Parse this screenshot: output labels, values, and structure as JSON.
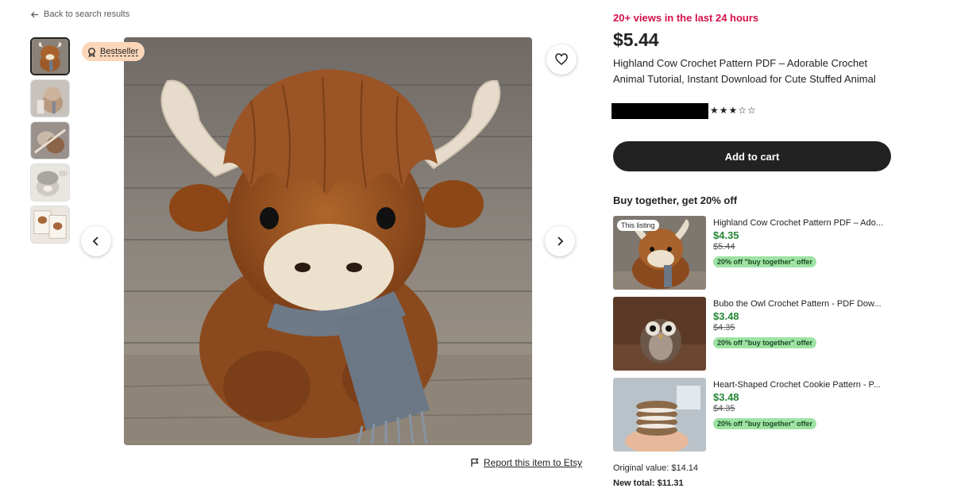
{
  "nav": {
    "back_label": "Back to search results"
  },
  "gallery": {
    "badge_label": "Bestseller",
    "report_label": "Report this item to Etsy",
    "thumbnails": [
      {
        "subject": "highland cow amigurumi",
        "active": true
      },
      {
        "subject": "highland cow amigurumi variant",
        "active": false
      },
      {
        "subject": "crochet in progress",
        "active": false
      },
      {
        "subject": "gray cow amigurumi",
        "active": false
      },
      {
        "subject": "pattern pages",
        "active": false
      }
    ]
  },
  "listing": {
    "views_text": "20+ views in the last 24 hours",
    "price": "$5.44",
    "title": "Highland Cow Crochet Pattern PDF – Adorable Crochet Animal Tutorial, Instant Download for Cute Stuffed Animal",
    "rating": {
      "stars": "★★★☆☆"
    },
    "add_to_cart_label": "Add to cart"
  },
  "bundle": {
    "heading": "Buy together, get 20% off",
    "this_listing_tag": "This listing",
    "items": [
      {
        "title": "Highland Cow Crochet Pattern PDF – Ado...",
        "price": "$4.35",
        "old_price": "$5.44",
        "offer": "20% off \"buy together\" offer"
      },
      {
        "title": "Bubo the Owl Crochet Pattern - PDF Dow...",
        "price": "$3.48",
        "old_price": "$4.35",
        "offer": "20% off \"buy together\" offer"
      },
      {
        "title": "Heart-Shaped Crochet Cookie Pattern - P...",
        "price": "$3.48",
        "old_price": "$4.35",
        "offer": "20% off \"buy together\" offer"
      }
    ],
    "original_value": "Original value: $14.14",
    "new_total": "New total: $11.31"
  },
  "colors": {
    "views_red": "#d5104a",
    "price_green": "#258635",
    "offer_bg": "#9ee3a4",
    "badge_bg": "#fbd6b8"
  },
  "icons": [
    "arrow-left-icon",
    "medal-icon",
    "heart-icon",
    "chevron-left-icon",
    "chevron-right-icon",
    "flag-icon"
  ]
}
